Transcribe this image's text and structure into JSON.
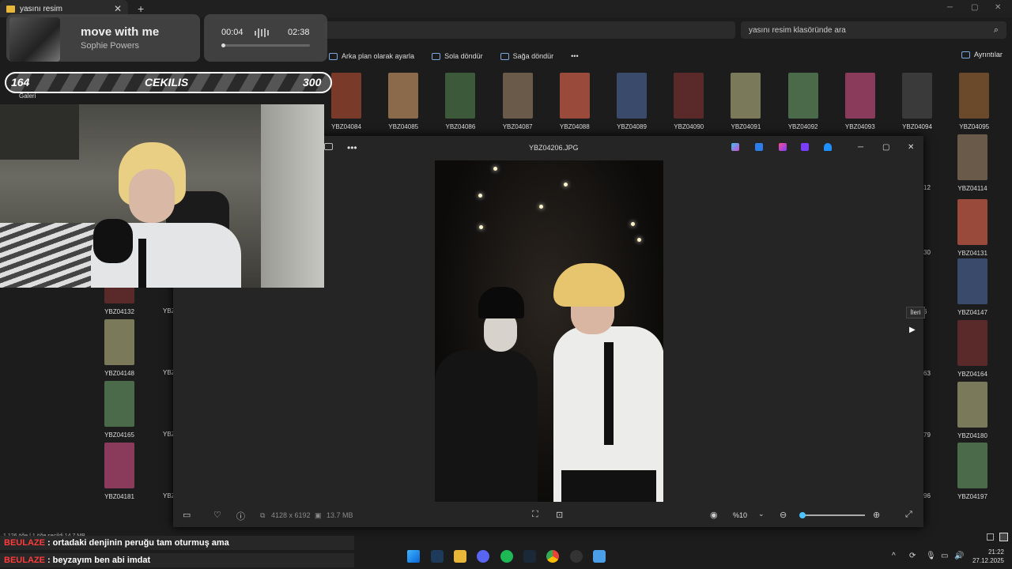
{
  "window": {
    "tab_title": "yasını resim",
    "close": "✕",
    "new_tab": "+",
    "minimize": "─",
    "maximize": "▢",
    "close_win": "✕"
  },
  "search": {
    "placeholder": "yasını resim klasöründe ara",
    "icon": "search-icon"
  },
  "toolbar": {
    "set_bg": "Arka plan olarak ayarla",
    "rotate_left": "Sola döndür",
    "rotate_right": "Sağa döndür",
    "more": "•••",
    "details": "Ayrıntılar"
  },
  "music": {
    "title": "move with me",
    "artist": "Sophie Powers",
    "elapsed": "00:04",
    "duration": "02:38",
    "progress": 0.025
  },
  "cekilis": {
    "left": "164",
    "label": "CEKILIS",
    "right": "300"
  },
  "galeri": "Galeri",
  "thumbs_top": [
    "YBZ04084",
    "YBZ04085",
    "YBZ04086",
    "YBZ04087",
    "YBZ04088",
    "YBZ04089",
    "YBZ04090",
    "YBZ04091",
    "YBZ04092",
    "YBZ04093",
    "YBZ04094",
    "YBZ04095"
  ],
  "thumbs_right": [
    {
      "id": "YBZ04114",
      "partial": "12"
    },
    {
      "id": "YBZ04131",
      "partial": "30"
    },
    {
      "id": "YBZ04147",
      "partial": "6"
    },
    {
      "id": "YBZ04164",
      "partial": "63"
    },
    {
      "id": "YBZ04180",
      "partial": "79"
    },
    {
      "id": "YBZ04197",
      "partial": "96"
    }
  ],
  "thumbs_left": [
    {
      "id": "YBZ04132",
      "partial": "YBZ"
    },
    {
      "id": "YBZ04148",
      "partial": "YBZ"
    },
    {
      "id": "YBZ04165",
      "partial": "YBZ"
    },
    {
      "id": "YBZ04181",
      "partial": "YBZ"
    }
  ],
  "viewer": {
    "filename": "YBZ04206.JPG",
    "more": "•••",
    "dimensions": "4128 x 6192",
    "filesize": "13.7 MB",
    "zoom": "%10",
    "zoom_level": 0.1,
    "tooltip": "İleri",
    "next": "▶",
    "min": "─",
    "max": "▢",
    "close": "✕"
  },
  "status": "1.126 öğe  |  1 öğe seçildi  14,7 MB",
  "chat": [
    {
      "name": "BEULAZE",
      "message": ": ortadaki denjinin peruğu tam oturmuş ama"
    },
    {
      "name": "BEULAZE",
      "message": ": beyzayım ben abi imdat"
    }
  ],
  "taskbar": {
    "time": "21:22",
    "date": "27.12.2025",
    "tray_up": "^"
  },
  "colors": {
    "accent": "#4cc2ff",
    "chat_name": "#ff3b3b",
    "folder": "#e8b73a"
  }
}
